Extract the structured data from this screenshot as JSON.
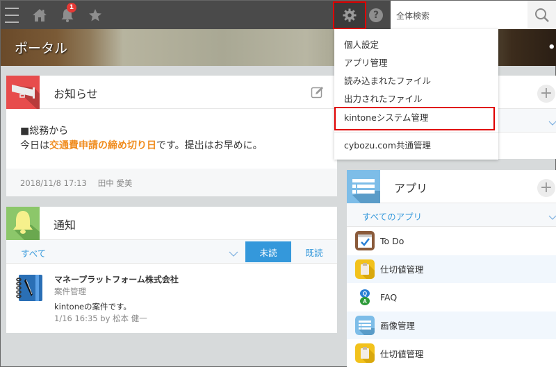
{
  "topbar": {
    "notification_count": "1",
    "search_placeholder": "全体検索",
    "icons": [
      "menu-icon",
      "home-icon",
      "bell-icon",
      "star-icon",
      "gear-icon",
      "help-icon",
      "search-icon"
    ]
  },
  "banner": {
    "title": "ポータル",
    "more": "••"
  },
  "settings_menu": {
    "items": [
      {
        "label": "個人設定"
      },
      {
        "label": "アプリ管理"
      },
      {
        "label": "読み込まれたファイル"
      },
      {
        "label": "出力されたファイル"
      },
      {
        "label": "kintoneシステム管理",
        "highlighted": true
      },
      {
        "label": "cybozu.com共通管理"
      }
    ]
  },
  "notice": {
    "title": "お知らせ",
    "line1": "■総務から",
    "line2_pre": "今日は",
    "line2_highlight": "交通費申請の締め切り日",
    "line2_post": "です。提出はお早めに。",
    "highlight_color": "#f08c1e",
    "date": "2018/11/8 17:13",
    "author": "田中 愛美"
  },
  "notifications": {
    "title": "通知",
    "filter": "すべて",
    "tabs": [
      {
        "label": "未読",
        "active": true
      },
      {
        "label": "既読",
        "active": false
      }
    ],
    "items": [
      {
        "title": "マネープラットフォーム株式会社",
        "app": "案件管理",
        "body": "kintoneの案件です。",
        "meta": "1/16 16:35  by 松本 健一"
      }
    ]
  },
  "apps": {
    "title": "アプリ",
    "filter": "すべてのアプリ",
    "items": [
      {
        "name": "To Do",
        "icon": "todo-icon"
      },
      {
        "name": "仕切値管理",
        "icon": "clipboard-icon"
      },
      {
        "name": "FAQ",
        "icon": "qa-icon"
      },
      {
        "name": "画像管理",
        "icon": "list-icon"
      },
      {
        "name": "仕切値管理",
        "icon": "clipboard-icon"
      }
    ]
  },
  "colors": {
    "accent": "#3498db",
    "topbar": "#4a4a4a",
    "highlight_box": "#e00000"
  }
}
